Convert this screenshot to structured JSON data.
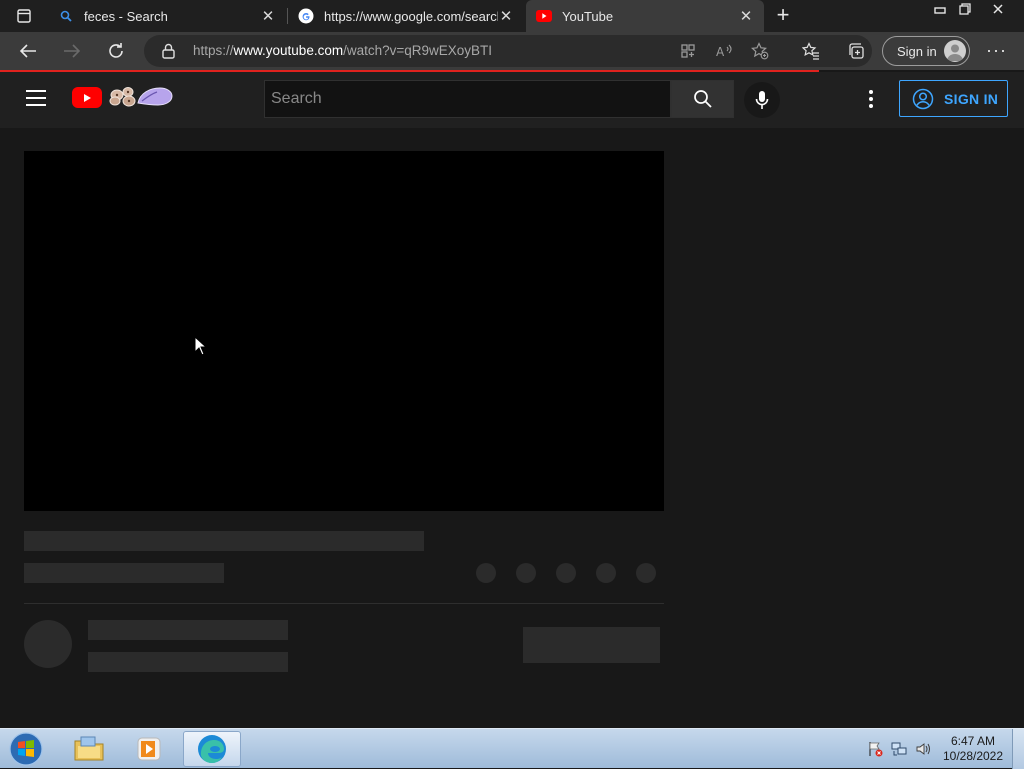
{
  "browser": {
    "tabs": [
      {
        "title": "feces - Search",
        "active": false
      },
      {
        "title": "https://www.google.com/search?",
        "active": false
      },
      {
        "title": "YouTube",
        "active": true
      }
    ],
    "address_prefix": "https://",
    "address_domain": "www.youtube.com",
    "address_path": "/watch?v=qR9wEXoyBTI",
    "sign_in_label": "Sign in",
    "load_progress": 0.8
  },
  "youtube": {
    "search_placeholder": "Search",
    "sign_in_label": "SIGN IN",
    "accent_color": "#3ea6ff",
    "brand_color": "#ff0000"
  },
  "taskbar": {
    "time": "6:47 AM",
    "date": "10/28/2022"
  }
}
